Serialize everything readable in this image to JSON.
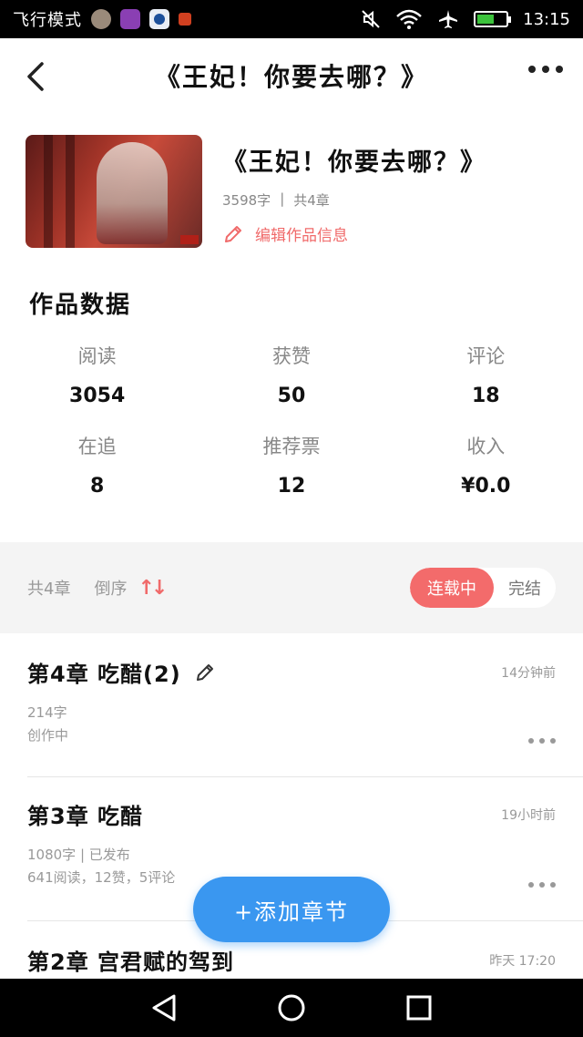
{
  "status_bar": {
    "mode_text": "飞行模式",
    "time": "13:15",
    "icons": [
      "mute-icon",
      "wifi-icon",
      "airplane-icon",
      "battery-charging-icon"
    ]
  },
  "header": {
    "title": "《王妃！你要去哪？》"
  },
  "book": {
    "title": "《王妃！你要去哪？》",
    "word_count": "3598字",
    "separator": "|",
    "chapter_count": "共4章",
    "edit_label": "编辑作品信息"
  },
  "stats": {
    "title": "作品数据",
    "items": [
      {
        "label": "阅读",
        "value": "3054"
      },
      {
        "label": "获赞",
        "value": "50"
      },
      {
        "label": "评论",
        "value": "18"
      },
      {
        "label": "在追",
        "value": "8"
      },
      {
        "label": "推荐票",
        "value": "12"
      },
      {
        "label": "收入",
        "value": "¥0.0"
      }
    ]
  },
  "filter": {
    "count": "共4章",
    "sort_label": "倒序",
    "sort_icon": "↑↓",
    "status_active": "连载中",
    "status_inactive": "完结"
  },
  "chapters": [
    {
      "title": "第4章  吃醋(2)",
      "time": "14分钟前",
      "line1": "214字",
      "line2": "创作中",
      "editable": true
    },
    {
      "title": "第3章  吃醋",
      "time": "19小时前",
      "line1": "1080字 | 已发布",
      "line2": "641阅读，12赞，5评论",
      "editable": false
    },
    {
      "title": "第2章  宫君赋的驾到",
      "time": "昨天 17:20"
    }
  ],
  "fab": {
    "label": "+添加章节"
  },
  "colors": {
    "accent_red": "#f36b6b",
    "fab_blue": "#3a97f0"
  }
}
